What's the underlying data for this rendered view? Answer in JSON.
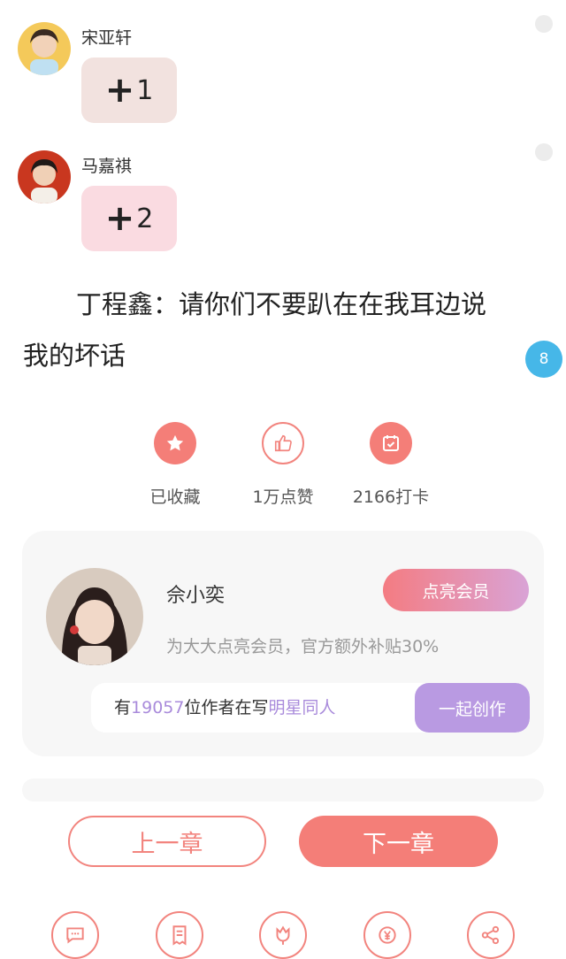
{
  "messages": [
    {
      "name": "宋亚轩",
      "badge_plus": "+",
      "badge_value": "1",
      "bubble_color": "#f2e2df"
    },
    {
      "name": "马嘉祺",
      "badge_plus": "+",
      "badge_value": "2",
      "bubble_color": "#fadbe1"
    }
  ],
  "narration": {
    "line1": "丁程鑫：请你们不要趴在在我耳边说",
    "line2": "我的坏话"
  },
  "comment_count": "8",
  "actions": [
    {
      "icon": "star-icon",
      "label": "已收藏"
    },
    {
      "icon": "thumbs-up-icon",
      "label": "1万点赞"
    },
    {
      "icon": "calendar-check-icon",
      "label": "2166打卡"
    }
  ],
  "author": {
    "name": "佘小奕",
    "vip_button": "点亮会员",
    "vip_tip": "为大大点亮会员，官方额外补贴30%",
    "write_prefix": "有",
    "write_count": "19057",
    "write_middle": "位作者在写",
    "write_topic": "明星同人",
    "write_button": "一起创作"
  },
  "nav": {
    "prev": "上一章",
    "next": "下一章"
  },
  "bottom_icons": [
    "comment-icon",
    "receipt-icon",
    "flower-icon",
    "yuan-icon",
    "share-icon"
  ],
  "colors": {
    "accent": "#f47e78",
    "purple": "#b99ae2",
    "badge_blue": "#46b7e8"
  }
}
